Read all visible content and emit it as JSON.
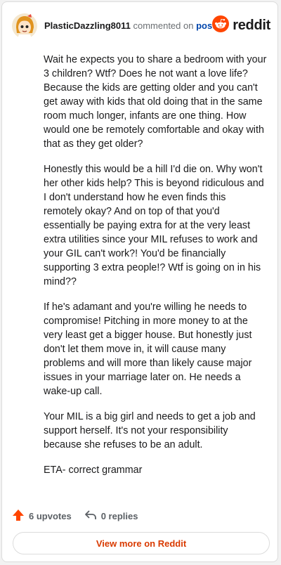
{
  "comment": {
    "username": "PlasticDazzling8011",
    "action": "commented on",
    "post_link": "post",
    "paragraphs": [
      "Wait he expects you to share a bedroom with your 3 children? Wtf? Does he not want a love life? Because the kids are getting older and you can't get away with kids that old doing that in the same room much longer, infants are one thing. How would one be remotely comfortable and okay with that as they get older?",
      "Honestly this would be a hill I'd die on. Why won't her other kids help? This is beyond ridiculous and I don't understand how he even finds this remotely okay? And on top of that you'd essentially be paying extra for at the very least extra utilities since your MIL refuses to work and your GIL can't work?! You'd be financially supporting 3 extra people!? Wtf is going on in his mind??",
      "If he's adamant and you're willing he needs to compromise! Pitching in more money to at the very least get a bigger house. But honestly just don't let them move in, it will cause many problems and will more than likely cause major issues in your marriage later on. He needs a wake-up call.",
      "Your MIL is a big girl and needs to get a job and support herself. It's not your responsibility because she refuses to be an adult.",
      "ETA- correct grammar"
    ]
  },
  "brand": {
    "name": "reddit",
    "icon": "reddit-snoo-icon",
    "color": "#ff4500"
  },
  "footer": {
    "upvotes": "6 upvotes",
    "replies": "0 replies",
    "upvote_icon": "upvote-arrow-icon",
    "reply_icon": "reply-arrow-icon",
    "upvote_color": "#ff4500"
  },
  "view_more": {
    "label": "View more on Reddit",
    "color": "#d93a00"
  },
  "avatar": {
    "icon": "user-avatar-icon"
  }
}
